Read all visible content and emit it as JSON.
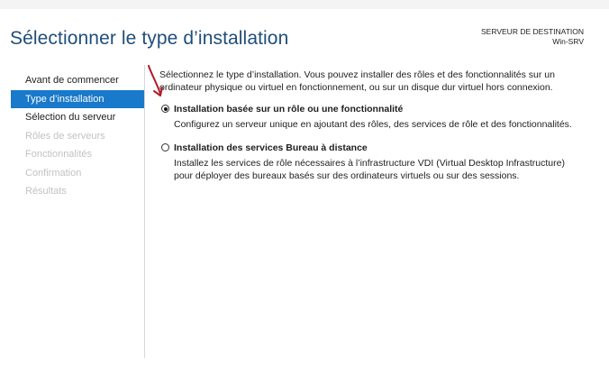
{
  "header": {
    "title": "Sélectionner le type d’installation",
    "destination_label": "SERVEUR DE DESTINATION",
    "destination_server": "Win-SRV"
  },
  "nav": {
    "items": [
      {
        "label": "Avant de commencer",
        "state": "normal"
      },
      {
        "label": "Type d’installation",
        "state": "active"
      },
      {
        "label": "Sélection du serveur",
        "state": "normal"
      },
      {
        "label": "Rôles de serveurs",
        "state": "disabled"
      },
      {
        "label": "Fonctionnalités",
        "state": "disabled"
      },
      {
        "label": "Confirmation",
        "state": "disabled"
      },
      {
        "label": "Résultats",
        "state": "disabled"
      }
    ]
  },
  "content": {
    "intro": "Sélectionnez le type d’installation. Vous pouvez installer des rôles et des fonctionnalités sur un ordinateur physique ou virtuel en fonctionnement, ou sur un disque dur virtuel hors connexion.",
    "options": [
      {
        "title": "Installation basée sur un rôle ou une fonctionnalité",
        "description": "Configurez un serveur unique en ajoutant des rôles, des services de rôle et des fonctionnalités.",
        "selected": true
      },
      {
        "title": "Installation des services Bureau à distance",
        "description": "Installez les services de rôle nécessaires à l’infrastructure VDI (Virtual Desktop Infrastructure) pour déployer des bureaux basés sur des ordinateurs virtuels ou sur des sessions.",
        "selected": false
      }
    ]
  },
  "colors": {
    "title": "#1f4e7a",
    "nav_active": "#1979ca",
    "nav_disabled": "#c2c2c2",
    "annotation_arrow": "#b01d2a"
  }
}
